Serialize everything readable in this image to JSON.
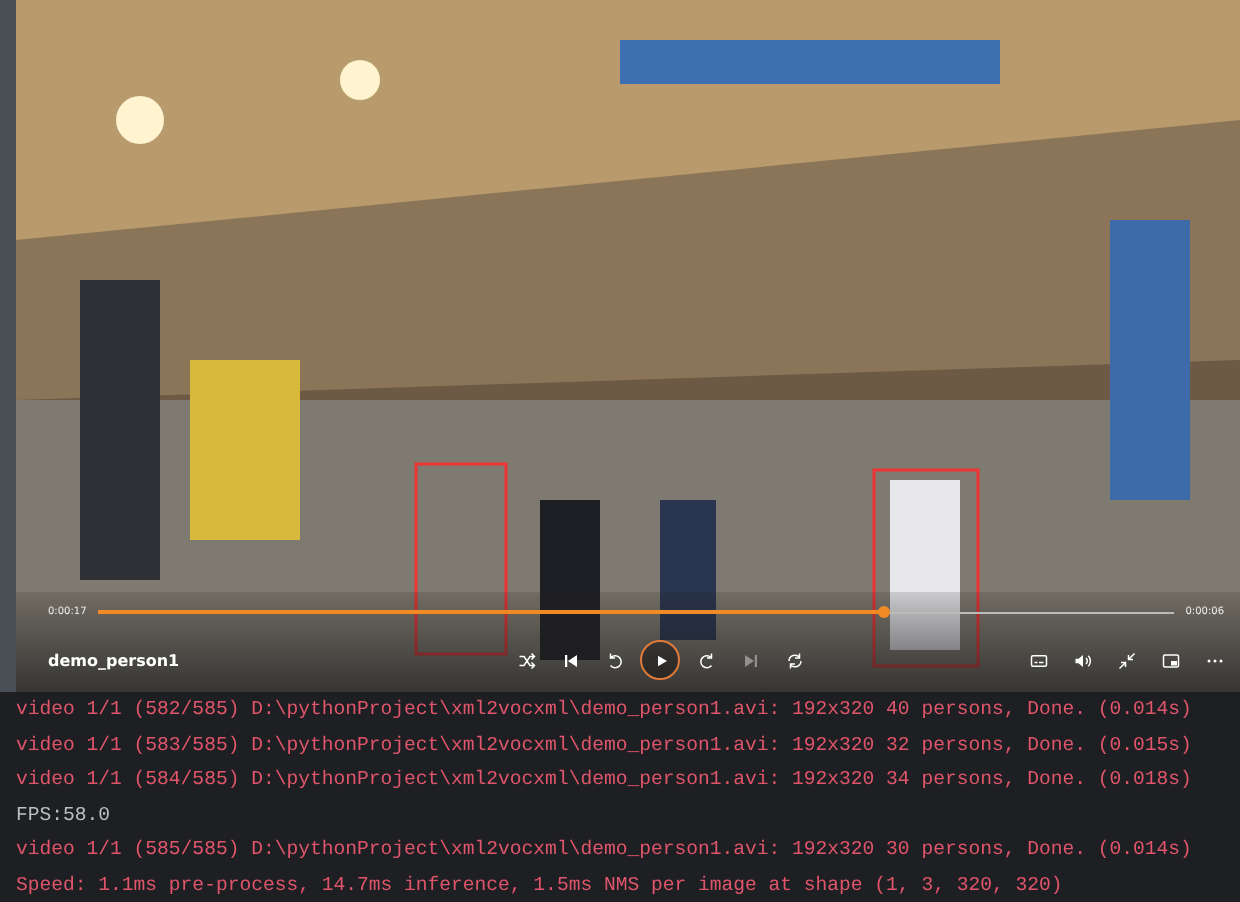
{
  "player": {
    "title": "demo_person1",
    "elapsed": "0:00:17",
    "remaining": "0:00:06",
    "progress": {
      "level": 0.73
    },
    "controls": [
      {
        "kind": "shuffle",
        "disabled": false
      },
      {
        "kind": "previous",
        "disabled": false
      },
      {
        "kind": "rewind",
        "disabled": false
      },
      {
        "kind": "play",
        "disabled": false
      },
      {
        "kind": "forward",
        "disabled": false
      },
      {
        "kind": "next",
        "disabled": true
      },
      {
        "kind": "repeat",
        "disabled": false
      }
    ],
    "right_controls": [
      {
        "kind": "captions"
      },
      {
        "kind": "volume"
      },
      {
        "kind": "collapse"
      },
      {
        "kind": "mini"
      },
      {
        "kind": "more"
      }
    ]
  },
  "console": {
    "lines": [
      {
        "kind": "stderr",
        "text": "video 1/1 (582/585) D:\\pythonProject\\xml2vocxml\\demo_person1.avi: 192x320 40 persons, Done. (0.014s)"
      },
      {
        "kind": "stderr",
        "text": "video 1/1 (583/585) D:\\pythonProject\\xml2vocxml\\demo_person1.avi: 192x320 32 persons, Done. (0.015s)"
      },
      {
        "kind": "stderr",
        "text": "video 1/1 (584/585) D:\\pythonProject\\xml2vocxml\\demo_person1.avi: 192x320 34 persons, Done. (0.018s)"
      },
      {
        "kind": "stdout",
        "text": "FPS:58.0"
      },
      {
        "kind": "stderr",
        "text": "video 1/1 (585/585) D:\\pythonProject\\xml2vocxml\\demo_person1.avi: 192x320 30 persons, Done. (0.014s)"
      },
      {
        "kind": "stderr",
        "text": "Speed: 1.1ms pre-process, 14.7ms inference, 1.5ms NMS per image at shape (1, 3, 320, 320)"
      }
    ]
  }
}
